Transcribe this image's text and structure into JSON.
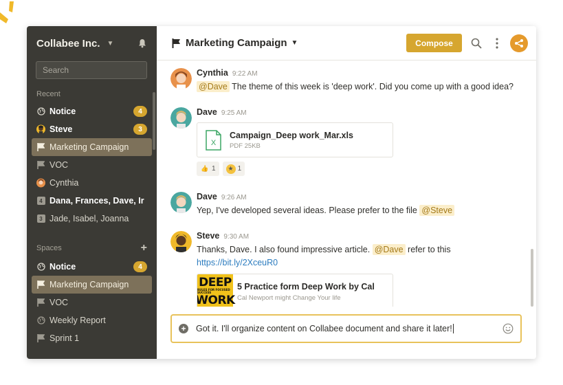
{
  "workspace": {
    "name": "Collabee Inc."
  },
  "sidebar": {
    "search_placeholder": "Search",
    "recent_label": "Recent",
    "recent": [
      {
        "label": "Notice",
        "icon": "globe-icon",
        "bold": true,
        "badge": "4"
      },
      {
        "label": "Steve",
        "icon": "avatar-steve",
        "bold": true,
        "badge": "3"
      },
      {
        "label": "Marketing Campaign",
        "icon": "flag-icon",
        "active": true
      },
      {
        "label": "VOC",
        "icon": "flag-icon"
      },
      {
        "label": "Cynthia",
        "icon": "avatar-cynthia"
      },
      {
        "label": "Dana, Frances, Dave, Ir",
        "icon": "group-4-icon",
        "bold": true,
        "count": "4"
      },
      {
        "label": "Jade, Isabel, Joanna",
        "icon": "group-3-icon",
        "count": "3"
      }
    ],
    "spaces_label": "Spaces",
    "spaces": [
      {
        "label": "Notice",
        "icon": "globe-icon",
        "bold": true,
        "badge": "4"
      },
      {
        "label": "Marketing Campaign",
        "icon": "flag-icon",
        "active": true
      },
      {
        "label": "VOC",
        "icon": "flag-icon"
      },
      {
        "label": "Weekly Report",
        "icon": "globe-icon"
      },
      {
        "label": "Sprint 1",
        "icon": "flag-icon"
      }
    ]
  },
  "header": {
    "title": "Marketing Campaign",
    "compose_label": "Compose"
  },
  "messages": [
    {
      "name": "Cynthia",
      "time": "9:22 AM",
      "mention": "@Dave",
      "text": "The theme of this week is 'deep work'. Did you come up with a good idea?"
    },
    {
      "name": "Dave",
      "time": "9:25 AM",
      "file": {
        "name": "Campaign_Deep work_Mar.xls",
        "meta": "PDF  25KB"
      },
      "reactions": [
        {
          "emoji": "thumbs-up",
          "count": "1"
        },
        {
          "emoji": "star-struck",
          "count": "1"
        }
      ]
    },
    {
      "name": "Dave",
      "time": "9:26 AM",
      "text": "Yep, I've developed several ideas. Please prefer to the file",
      "mention": "@Steve"
    },
    {
      "name": "Steve",
      "time": "9:30 AM",
      "text_before": "Thanks, Dave. I also found impressive article.",
      "mention": "@Dave",
      "text_after": "refer to this",
      "link": "https://bit.ly/2XceuR0",
      "link_card": {
        "thumb_line1": "DEEP",
        "thumb_line2": "RULES FOR FOCUSED SUCCESS",
        "thumb_line3": "WORK",
        "title": "5 Practice form Deep Work by Cal",
        "subtitle": "Cal Newport might Change Your life"
      }
    }
  ],
  "composer": {
    "value": "Got it. I'll organize content on Collabee document and share it later!"
  },
  "colors": {
    "accent": "#d6a62f",
    "sidebar_bg": "#3b3a35",
    "active_item": "#7d715a",
    "link": "#2c7cbf"
  }
}
